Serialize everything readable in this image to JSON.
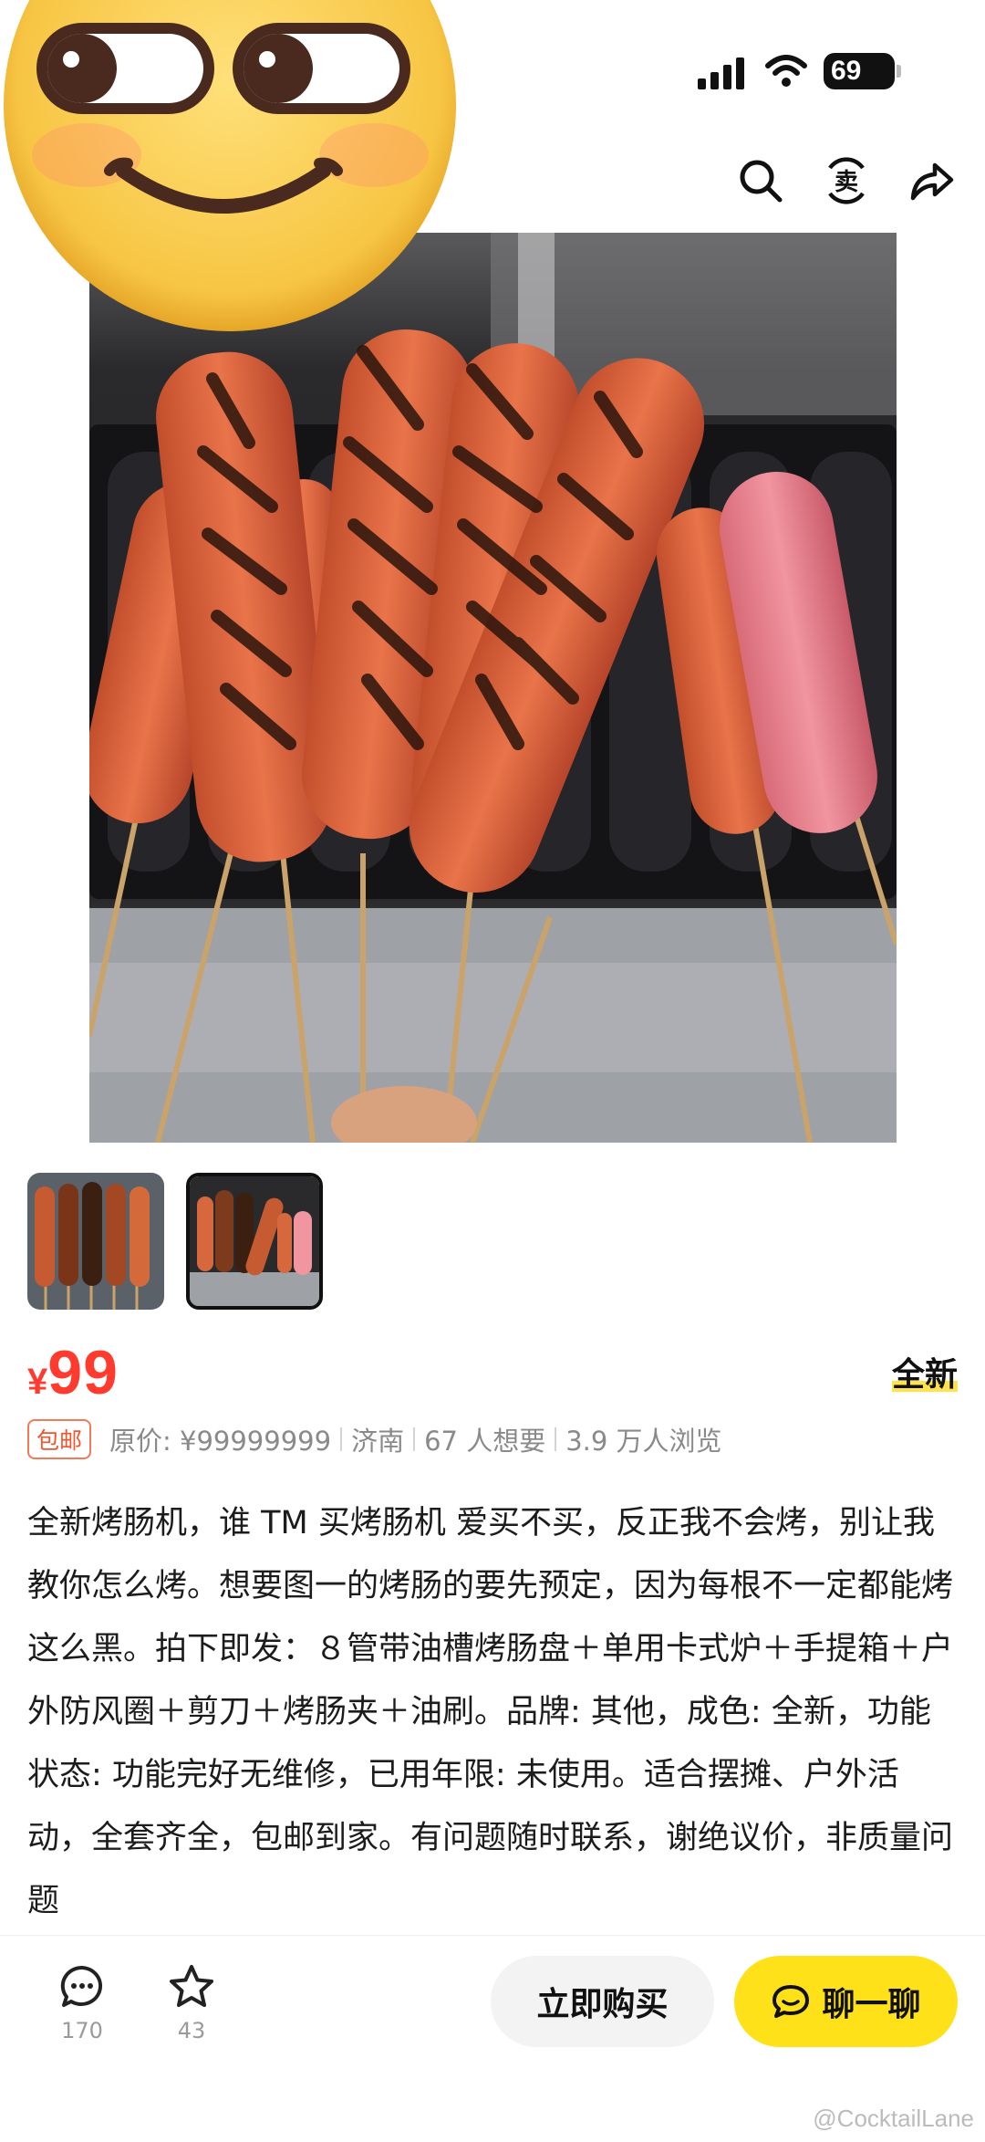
{
  "status_bar": {
    "battery": "69"
  },
  "listing": {
    "price_symbol": "¥",
    "price": "99",
    "condition": "全新",
    "badge": "包邮",
    "original_price": "原价: ¥99999999",
    "location": "济南",
    "wants": "67 人想要",
    "views": "3.9 万人浏览",
    "description": "全新烤肠机，谁 TM 买烤肠机 爱买不买，反正我不会烤，别让我教你怎么烤。想要图一的烤肠的要先预定，因为每根不一定都能烤这么黑。拍下即发：８管带油槽烤肠盘＋单用卡式炉＋手提箱＋户外防风圈＋剪刀＋烤肠夹＋油刷。品牌: 其他，成色: 全新，功能状态: 功能完好无维修，已用年限: 未使用。适合摆摊、户外活动，全套齐全，包邮到家。有问题随时联系，谢绝议价，非质量问题"
  },
  "bottom_bar": {
    "comment_count": "170",
    "favorite_count": "43",
    "buy_label": "立即购买",
    "chat_label": "聊一聊"
  },
  "watermark": "@CocktailLane",
  "icons": [
    "search-icon",
    "sell-icon",
    "share-icon",
    "comment-icon",
    "star-icon",
    "chat-icon"
  ],
  "colors": {
    "price": "#ff3b30",
    "chat_button": "#ffe119",
    "badge": "#f0552e"
  }
}
